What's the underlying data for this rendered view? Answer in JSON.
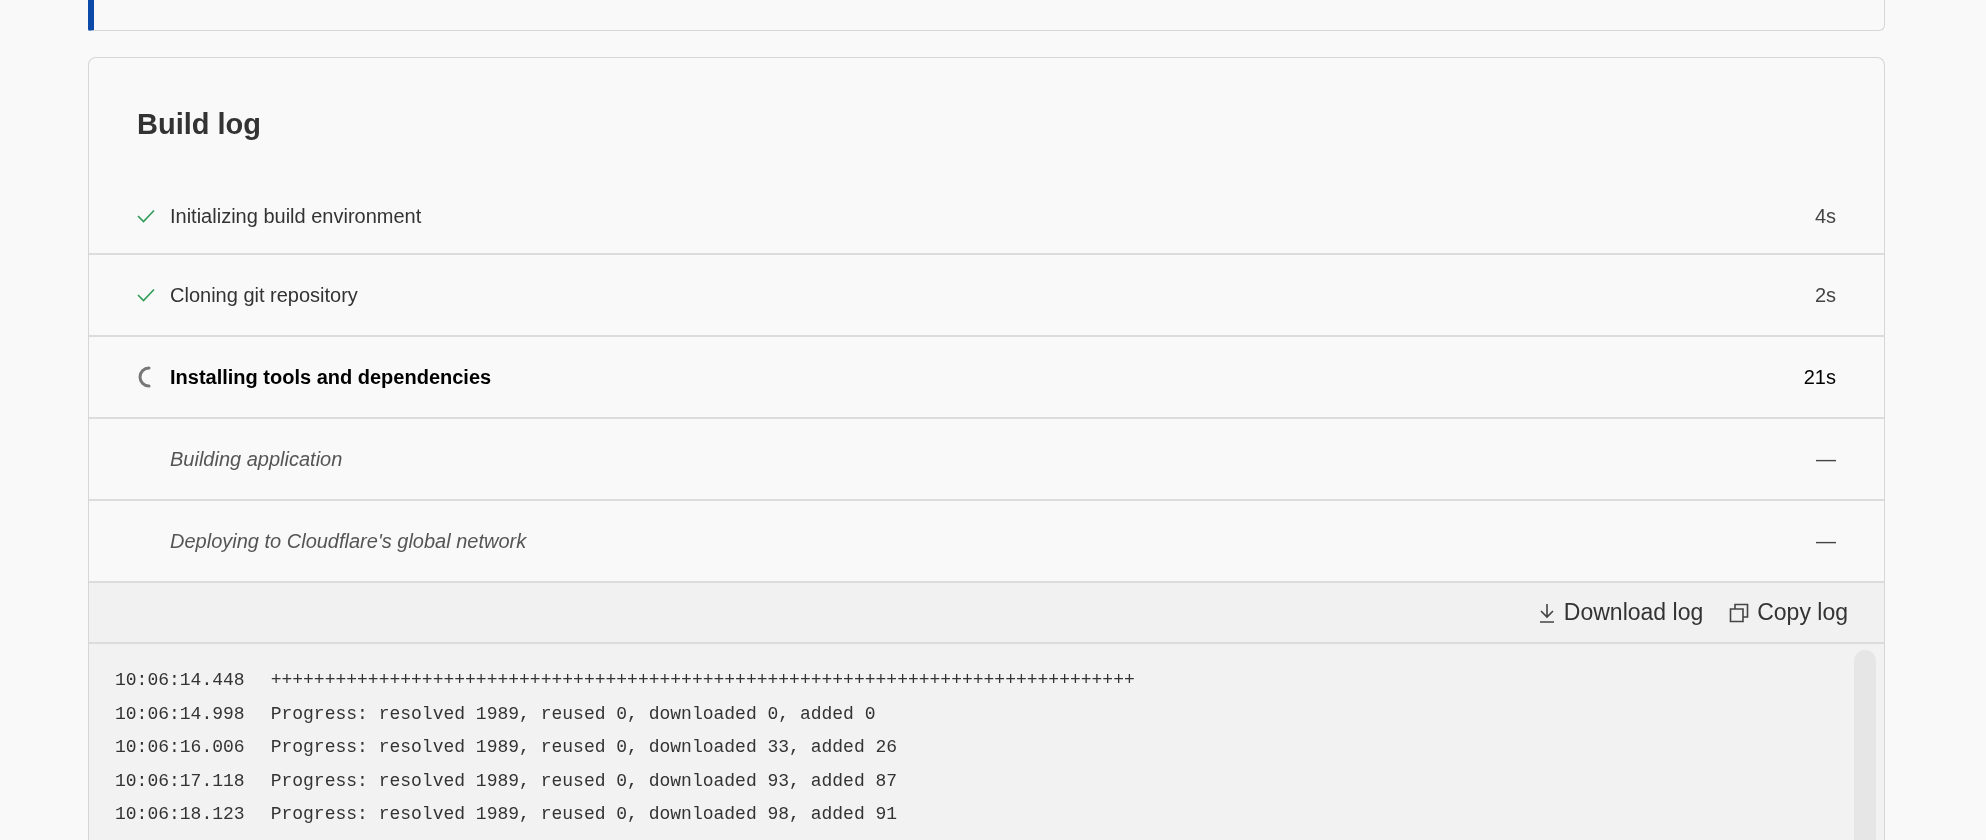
{
  "build_log": {
    "title": "Build log",
    "steps": [
      {
        "label": "Initializing build environment",
        "duration": "4s",
        "kind": "done"
      },
      {
        "label": "Cloning git repository",
        "duration": "2s",
        "kind": "done"
      },
      {
        "label": "Installing tools and dependencies",
        "duration": "21s",
        "kind": "running"
      },
      {
        "label": "Building application",
        "duration": "—",
        "kind": "pending"
      },
      {
        "label": "Deploying to Cloudflare's global network",
        "duration": "—",
        "kind": "pending"
      }
    ],
    "actions": [
      {
        "label": "Download log",
        "kind": "download"
      },
      {
        "label": "Copy log",
        "kind": "copy"
      }
    ],
    "log": [
      {
        "time": "10:06:14.448",
        "message": "++++++++++++++++++++++++++++++++++++++++++++++++++++++++++++++++++++++++++++++++"
      },
      {
        "time": "10:06:14.998",
        "message": "Progress: resolved 1989, reused 0, downloaded 0, added 0"
      },
      {
        "time": "10:06:16.006",
        "message": "Progress: resolved 1989, reused 0, downloaded 33, added 26"
      },
      {
        "time": "10:06:17.118",
        "message": "Progress: resolved 1989, reused 0, downloaded 93, added 87"
      },
      {
        "time": "10:06:18.123",
        "message": "Progress: resolved 1989, reused 0, downloaded 98, added 91"
      }
    ]
  }
}
